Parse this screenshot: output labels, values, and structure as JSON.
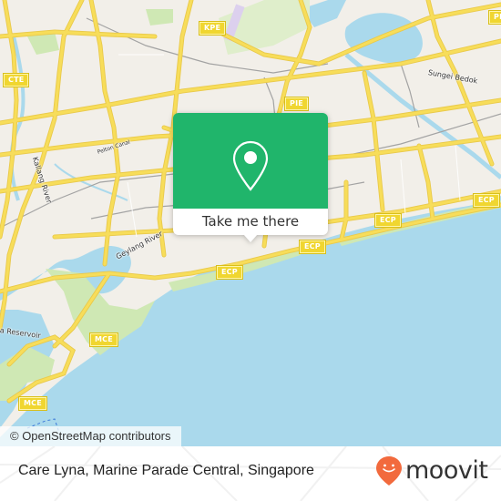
{
  "map": {
    "colors": {
      "land": "#f2efe9",
      "water": "#aad9ec",
      "park": "#cfe8b4",
      "road": "#f7dd5a",
      "road_edge": "#e9c94a",
      "rail": "#a3a3a3"
    },
    "shields": [
      {
        "id": "kpe",
        "label": "KPE"
      },
      {
        "id": "cte",
        "label": "CTE"
      },
      {
        "id": "pie-1",
        "label": "PIE"
      },
      {
        "id": "pie-2",
        "label": "PIE"
      },
      {
        "id": "ecp-1",
        "label": "ECP"
      },
      {
        "id": "ecp-2",
        "label": "ECP"
      },
      {
        "id": "ecp-3",
        "label": "ECP"
      },
      {
        "id": "ecp-4",
        "label": "ECP"
      },
      {
        "id": "mce-1",
        "label": "MCE"
      },
      {
        "id": "mce-2",
        "label": "MCE"
      }
    ],
    "labels": [
      {
        "id": "sungei-bedok",
        "text": "Sungei Bedok"
      },
      {
        "id": "geylang-river",
        "text": "Geylang River"
      },
      {
        "id": "kallang-river",
        "text": "Kallang River"
      },
      {
        "id": "pelton-canal",
        "text": "Pelton Canal"
      },
      {
        "id": "reservoir",
        "text": "a Reservoir"
      }
    ]
  },
  "popup": {
    "icon": "map-pin-icon",
    "action_label": "Take me there",
    "color": "#20b56b"
  },
  "attribution": "© OpenStreetMap contributors",
  "footer": {
    "place_name": "Care Lyna, Marine Parade Central, Singapore",
    "brand": {
      "name": "moovit",
      "icon": "moovit-smiley-pin-icon",
      "color": "#f26a3d"
    }
  }
}
